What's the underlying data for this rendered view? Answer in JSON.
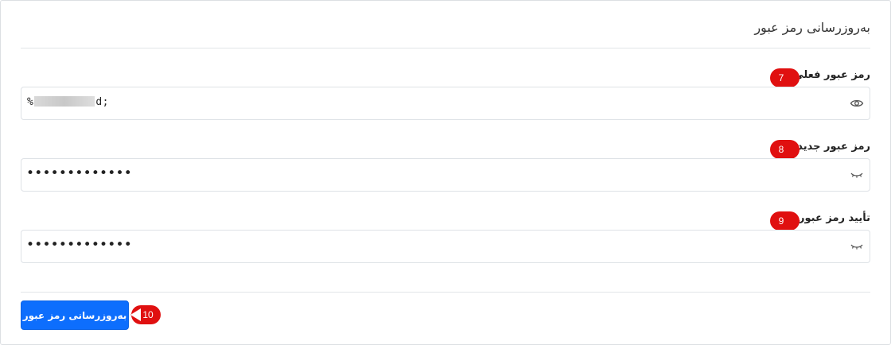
{
  "card": {
    "title": "بەروزرسانی رمز عبور"
  },
  "fields": [
    {
      "label": "رمز عبور فعلی",
      "value_start": "%",
      "value_end": "d;",
      "value_redacted": true,
      "visibility_icon": "eye-icon",
      "badge": "7"
    },
    {
      "label": "رمز عبور جدید",
      "masked_value": "•••••••••••••",
      "visibility_icon": "eye-closed-icon",
      "badge": "8"
    },
    {
      "label": "تأیید رمز عبور",
      "masked_value": "•••••••••••••",
      "visibility_icon": "eye-closed-icon",
      "badge": "9"
    }
  ],
  "submit": {
    "label": "بەروزرسانی رمز عبور",
    "badge": "10"
  },
  "colors": {
    "primary": "#0d6efd",
    "badge_red": "#e01010",
    "border": "#dee2e6"
  }
}
